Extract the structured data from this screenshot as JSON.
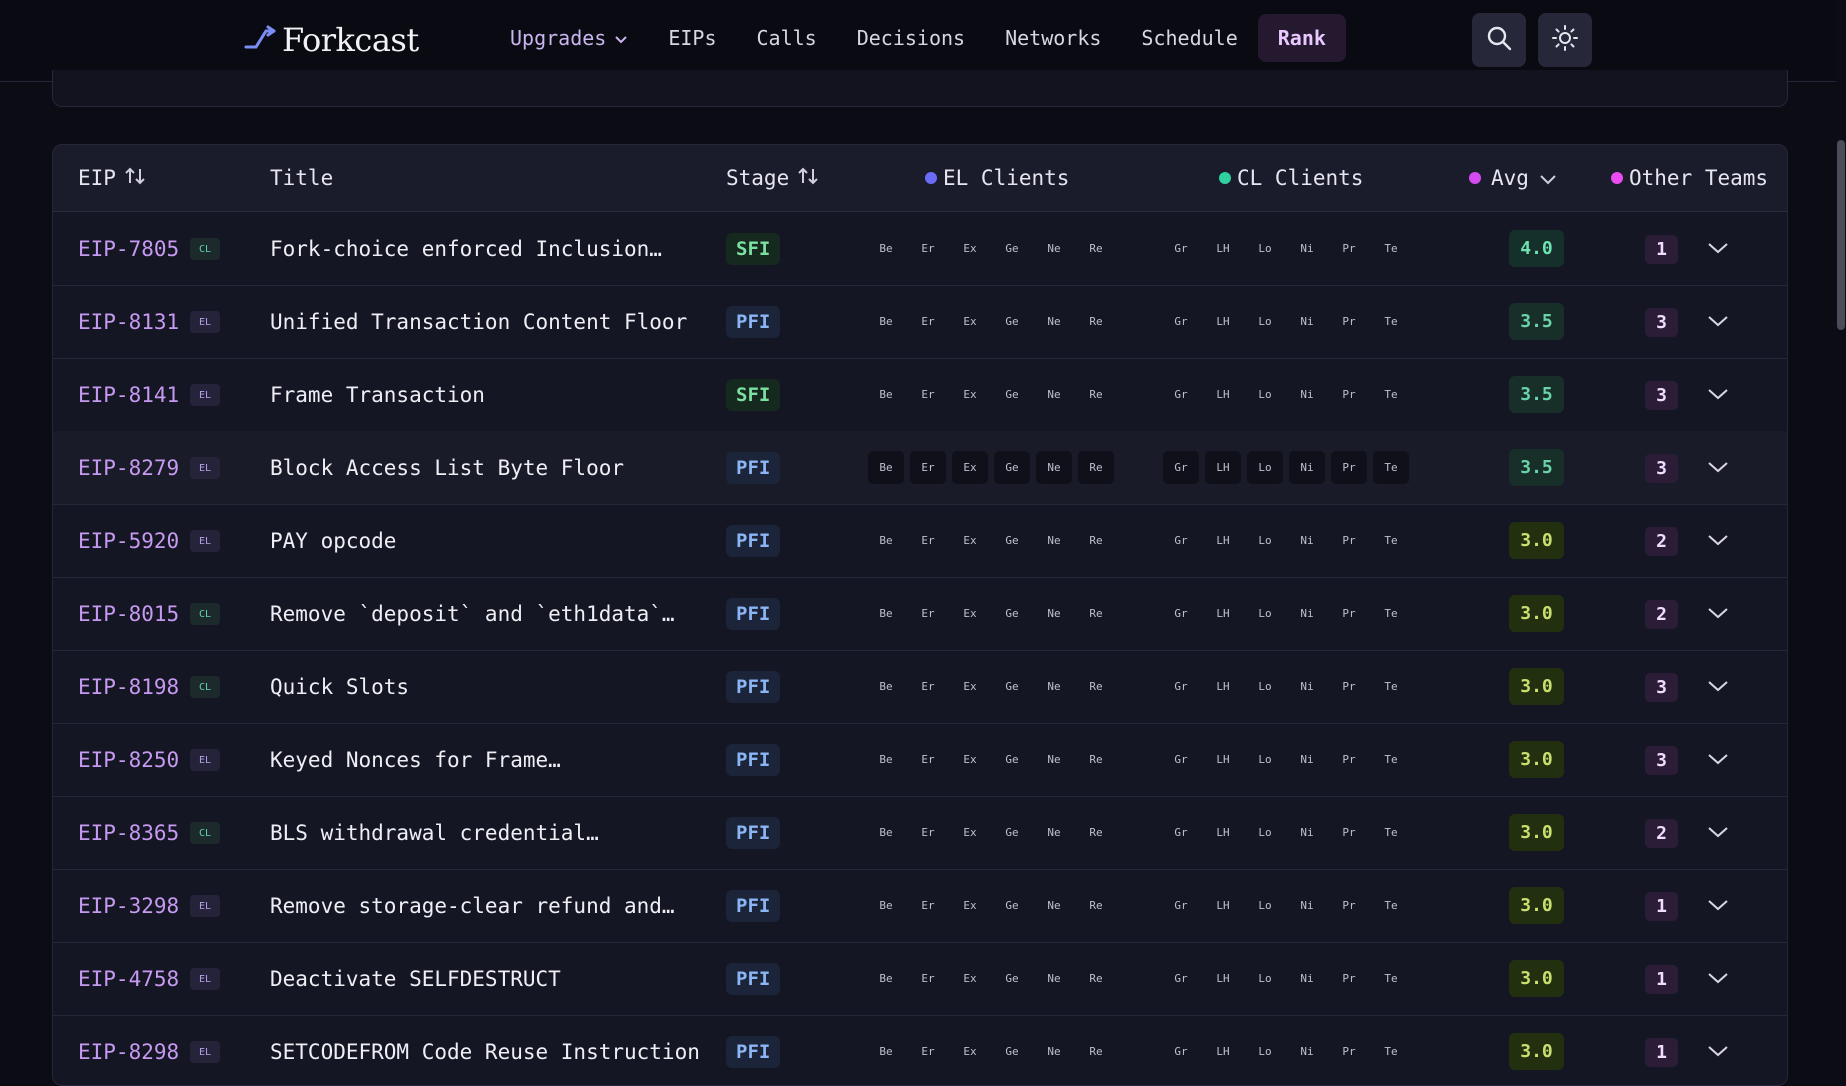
{
  "app": {
    "name": "Forkcast"
  },
  "nav": {
    "upgrades": "Upgrades",
    "eips": "EIPs",
    "calls": "Calls",
    "decisions": "Decisions",
    "networks": "Networks",
    "schedule": "Schedule",
    "rank": "Rank",
    "search_icon": "search-icon",
    "theme_icon": "sun-icon"
  },
  "columns": {
    "eip": "EIP",
    "title": "Title",
    "stage": "Stage",
    "el_clients": "EL Clients",
    "cl_clients": "CL Clients",
    "avg": "Avg",
    "other_teams": "Other Teams"
  },
  "colors": {
    "accent": "#c69af0",
    "el_dot": "#6b6cf5",
    "cl_dot": "#2fd1a0",
    "avg_dot": "#d44cf0",
    "teams_dot": "#e94cf2"
  },
  "el_clients": [
    "Be",
    "Er",
    "Ex",
    "Ge",
    "Ne",
    "Re"
  ],
  "cl_clients": [
    "Gr",
    "LH",
    "Lo",
    "Ni",
    "Pr",
    "Te"
  ],
  "rows": [
    {
      "eip": "EIP-7805",
      "layer": "CL",
      "title": "Fork-choice enforced Inclusion…",
      "stage": "SFI",
      "avg": "4.0",
      "teams": "1"
    },
    {
      "eip": "EIP-8131",
      "layer": "EL",
      "title": "Unified Transaction Content Floor",
      "stage": "PFI",
      "avg": "3.5",
      "teams": "3"
    },
    {
      "eip": "EIP-8141",
      "layer": "EL",
      "title": "Frame Transaction",
      "stage": "SFI",
      "avg": "3.5",
      "teams": "3"
    },
    {
      "eip": "EIP-8279",
      "layer": "EL",
      "title": "Block Access List Byte Floor",
      "stage": "PFI",
      "avg": "3.5",
      "teams": "3"
    },
    {
      "eip": "EIP-5920",
      "layer": "EL",
      "title": "PAY opcode",
      "stage": "PFI",
      "avg": "3.0",
      "teams": "2"
    },
    {
      "eip": "EIP-8015",
      "layer": "CL",
      "title": "Remove `deposit` and `eth1data`…",
      "stage": "PFI",
      "avg": "3.0",
      "teams": "2"
    },
    {
      "eip": "EIP-8198",
      "layer": "CL",
      "title": "Quick Slots",
      "stage": "PFI",
      "avg": "3.0",
      "teams": "3"
    },
    {
      "eip": "EIP-8250",
      "layer": "EL",
      "title": "Keyed Nonces for Frame…",
      "stage": "PFI",
      "avg": "3.0",
      "teams": "3"
    },
    {
      "eip": "EIP-8365",
      "layer": "CL",
      "title": "BLS withdrawal credential…",
      "stage": "PFI",
      "avg": "3.0",
      "teams": "2"
    },
    {
      "eip": "EIP-3298",
      "layer": "EL",
      "title": "Remove storage-clear refund and…",
      "stage": "PFI",
      "avg": "3.0",
      "teams": "1"
    },
    {
      "eip": "EIP-4758",
      "layer": "EL",
      "title": "Deactivate SELFDESTRUCT",
      "stage": "PFI",
      "avg": "3.0",
      "teams": "1"
    },
    {
      "eip": "EIP-8298",
      "layer": "EL",
      "title": "SETCODEFROM Code Reuse Instruction",
      "stage": "PFI",
      "avg": "3.0",
      "teams": "1"
    }
  ]
}
